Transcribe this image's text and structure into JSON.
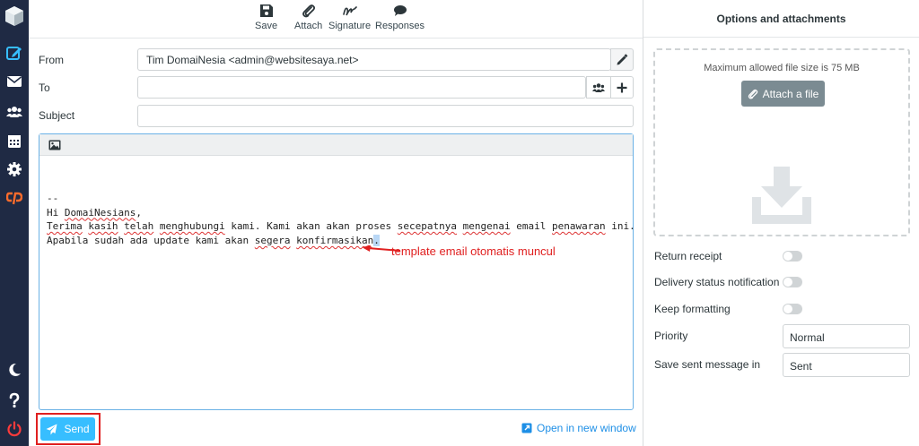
{
  "toolbar": {
    "save_label": "Save",
    "attach_label": "Attach",
    "signature_label": "Signature",
    "responses_label": "Responses"
  },
  "form": {
    "from_label": "From",
    "from_value": "Tim DomaiNesia <admin@websitesaya.net>",
    "to_label": "To",
    "to_value": "",
    "subject_label": "Subject",
    "subject_value": ""
  },
  "editor": {
    "body_lines": [
      "--",
      "Hi DomaiNesians,",
      "",
      "Terima kasih telah menghubungi kami. Kami akan akan proses secepatnya mengenai email penawaran ini.",
      "Apabila sudah ada update kami akan segera konfirmasikan."
    ],
    "annotation": "template email otomatis muncul"
  },
  "footer": {
    "send_label": "Send",
    "open_new_window_label": "Open in new window"
  },
  "sidebar": {
    "title": "Options and attachments",
    "max_file_size": "Maximum allowed file size is 75 MB",
    "attach_file_label": "Attach a file",
    "return_receipt_label": "Return receipt",
    "return_receipt_on": false,
    "dsn_label": "Delivery status notification",
    "dsn_on": false,
    "keep_formatting_label": "Keep formatting",
    "keep_formatting_on": false,
    "priority_label": "Priority",
    "priority_value": "Normal",
    "save_sent_label": "Save sent message in",
    "save_sent_value": "Sent"
  },
  "colors": {
    "nav_bg": "#1f2a44",
    "accent": "#37beff",
    "annotation": "#e02020",
    "link": "#1e8fe6"
  },
  "icons": [
    "compose-icon",
    "mail-icon",
    "contacts-icon",
    "calendar-icon",
    "settings-icon",
    "cpanel-icon",
    "moon-icon",
    "help-icon",
    "logout-icon",
    "save-icon",
    "paperclip-icon",
    "signature-icon",
    "responses-icon",
    "pencil-icon",
    "address-book-icon",
    "plus-icon",
    "image-icon",
    "send-icon",
    "external-window-icon",
    "download-icon"
  ]
}
